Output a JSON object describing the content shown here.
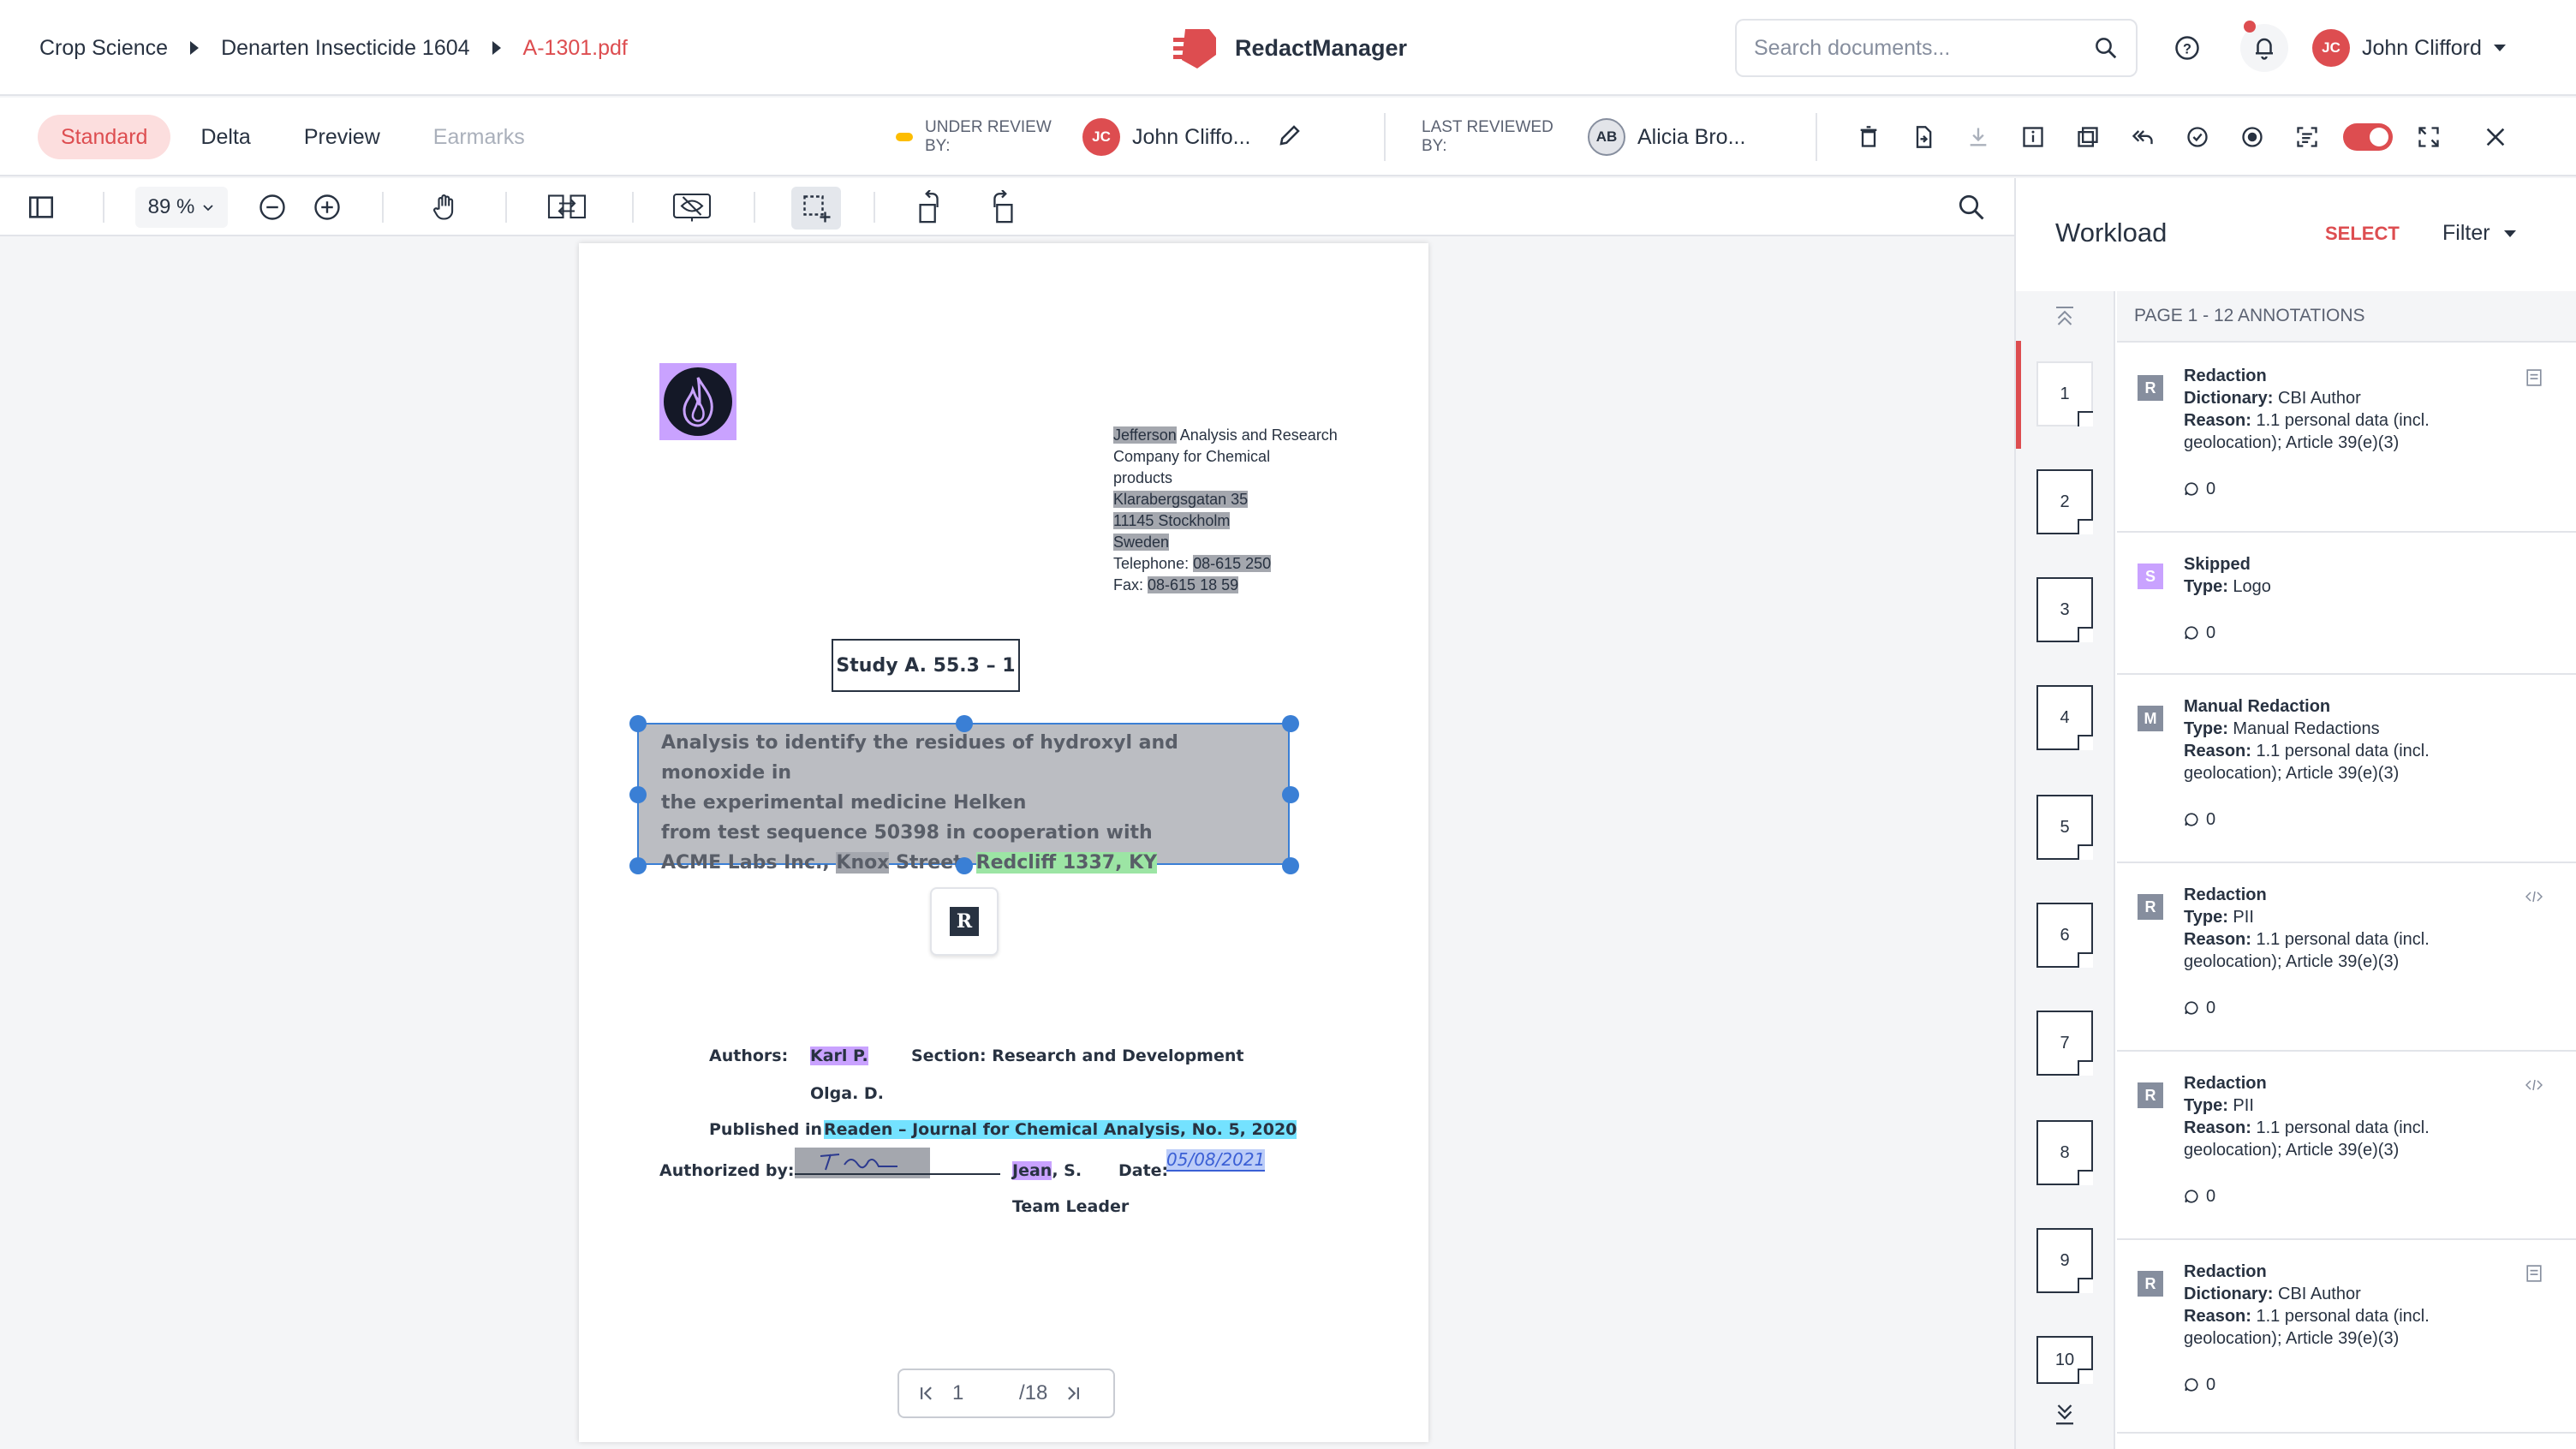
{
  "header": {
    "breadcrumbs": [
      "Crop Science",
      "Denarten Insecticide 1604",
      "A-1301.pdf"
    ],
    "brand": "RedactManager",
    "search_placeholder": "Search documents...",
    "user_initials": "JC",
    "user_name": "John Clifford"
  },
  "viewbar": {
    "tabs": [
      "Standard",
      "Delta",
      "Preview",
      "Earmarks"
    ],
    "under_review_label": "UNDER REVIEW BY:",
    "under_review_initials": "JC",
    "under_review_name": "John Cliffo...",
    "last_reviewed_label": "LAST REVIEWED BY:",
    "last_reviewed_initials": "AB",
    "last_reviewed_name": "Alicia Bro..."
  },
  "toolbar": {
    "zoom": "89 %"
  },
  "document": {
    "address_lines": [
      "Jefferson",
      " Analysis and Research",
      "Company for Chemical",
      "products",
      "Klarabergsgatan 35",
      "11145 Stockholm",
      "Sweden",
      "Telephone: ",
      "08-615 250",
      "Fax: ",
      "08-615 18 59"
    ],
    "study": "Study A. 55.3 – 1",
    "selection_lines": [
      "Analysis to identify the residues of hydroxyl and monoxide in",
      "the experimental medicine Helken",
      "from test sequence 50398 in cooperation with",
      "ACME Labs Inc., ",
      "Knox",
      " Street, ",
      "Redcliff 1337, KY"
    ],
    "r_marker": "R",
    "authors_label": "Authors:",
    "author1": "Karl P.",
    "section": "Section: Research and Development",
    "author2": "Olga. D.",
    "published_label": "Published in:",
    "published": "Readen – Journal for Chemical Analysis, No. 5, 2020",
    "authorized_label": "Authorized by:",
    "signer_first": "Jean",
    "signer_rest": ", S.",
    "date_label": "Date:",
    "date_value": "05/08/2021",
    "role": "Team Leader"
  },
  "pager": {
    "current": "1",
    "total": "/18"
  },
  "panel": {
    "title": "Workload",
    "select": "SELECT",
    "filter": "Filter",
    "section": "PAGE 1 - 12 ANNOTATIONS",
    "thumbs": [
      "1",
      "2",
      "3",
      "4",
      "5",
      "6",
      "7",
      "8",
      "9",
      "10"
    ],
    "annotations": [
      {
        "badge": "R",
        "color": "#868e9e",
        "title": "Redaction",
        "k1": "Dictionary:",
        "v1": " CBI Author",
        "k2": "Reason:",
        "v2": " 1.1 personal data (incl. geolocation); Article 39(e)(3)",
        "comments": "0"
      },
      {
        "badge": "S",
        "color": "#c9a2ff",
        "title": "Skipped",
        "k1": "Type:",
        "v1": " Logo",
        "k2": "",
        "v2": "",
        "comments": "0"
      },
      {
        "badge": "M",
        "color": "#868e9e",
        "title": "Manual Redaction",
        "k1": "Type:",
        "v1": " Manual Redactions",
        "k2": "Reason:",
        "v2": " 1.1 personal data (incl. geolocation); Article 39(e)(3)",
        "comments": "0"
      },
      {
        "badge": "R",
        "color": "#868e9e",
        "title": "Redaction",
        "k1": "Type:",
        "v1": " PII",
        "k2": "Reason:",
        "v2": " 1.1 personal data (incl. geolocation); Article 39(e)(3)",
        "comments": "0"
      },
      {
        "badge": "R",
        "color": "#868e9e",
        "title": "Redaction",
        "k1": "Type:",
        "v1": " PII",
        "k2": "Reason:",
        "v2": " 1.1 personal data (incl. geolocation); Article 39(e)(3)",
        "comments": "0"
      },
      {
        "badge": "R",
        "color": "#868e9e",
        "title": "Redaction",
        "k1": "Dictionary:",
        "v1": " CBI Author",
        "k2": "Reason:",
        "v2": " 1.1 personal data (incl. geolocation); Article 39(e)(3)",
        "comments": "0"
      }
    ]
  }
}
